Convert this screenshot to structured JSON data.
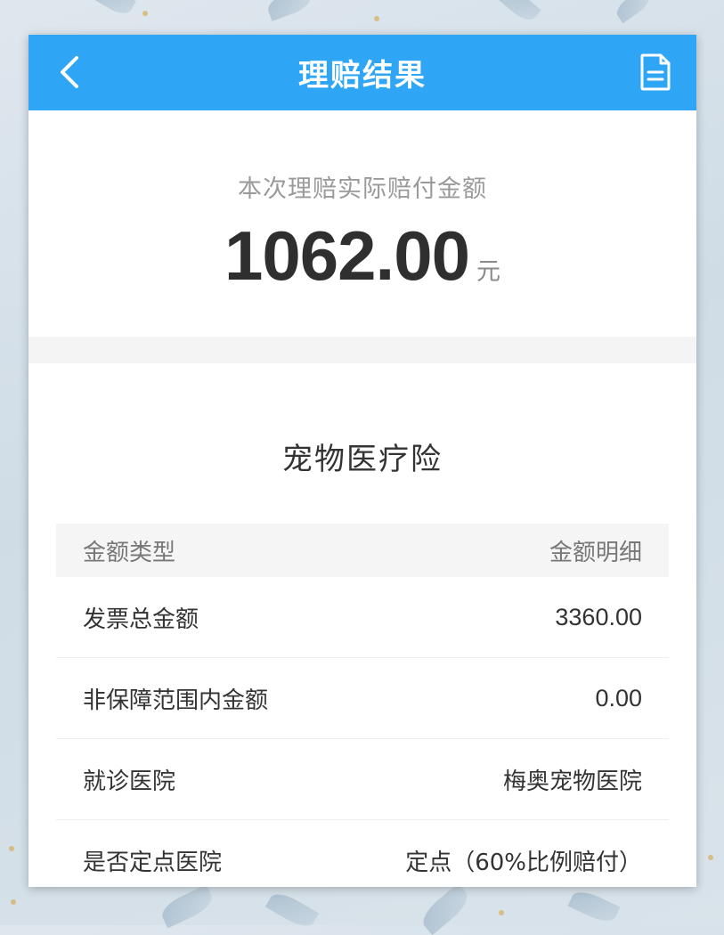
{
  "header": {
    "title": "理赔结果",
    "back_icon": "chevron-left-icon",
    "doc_icon": "document-icon"
  },
  "claim": {
    "label": "本次理赔实际赔付金额",
    "amount": "1062.00",
    "unit": "元"
  },
  "product": {
    "name": "宠物医疗险"
  },
  "table": {
    "header_left": "金额类型",
    "header_right": "金额明细",
    "rows": [
      {
        "label": "发票总金额",
        "value": "3360.00"
      },
      {
        "label": "非保障范围内金额",
        "value": "0.00"
      },
      {
        "label": "就诊医院",
        "value": "梅奥宠物医院"
      },
      {
        "label": "是否定点医院",
        "value": "定点（60%比例赔付）"
      }
    ]
  },
  "colors": {
    "header_bg": "#2ea5f5",
    "amount_text": "#2f2f2f",
    "label_text": "#9a9a9a"
  }
}
